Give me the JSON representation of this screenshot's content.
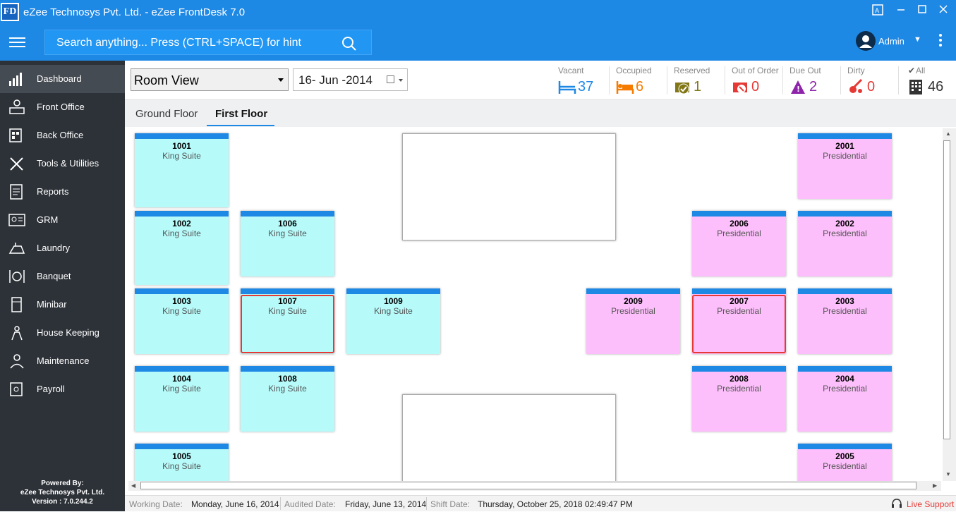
{
  "window": {
    "title": "eZee Technosys Pvt. Ltd. - eZee FrontDesk 7.0",
    "logo": "FD"
  },
  "header": {
    "search_placeholder": "Search anything... Press (CTRL+SPACE) for hint",
    "user": "Admin"
  },
  "sidebar": {
    "items": [
      {
        "label": "Dashboard",
        "icon": "dashboard-icon"
      },
      {
        "label": "Front Office",
        "icon": "front-office-icon"
      },
      {
        "label": "Back Office",
        "icon": "back-office-icon"
      },
      {
        "label": "Tools & Utilities",
        "icon": "tools-icon"
      },
      {
        "label": "Reports",
        "icon": "reports-icon"
      },
      {
        "label": "GRM",
        "icon": "grm-icon"
      },
      {
        "label": "Laundry",
        "icon": "laundry-icon"
      },
      {
        "label": "Banquet",
        "icon": "banquet-icon"
      },
      {
        "label": "Minibar",
        "icon": "minibar-icon"
      },
      {
        "label": "House Keeping",
        "icon": "housekeeping-icon"
      },
      {
        "label": "Maintenance",
        "icon": "maintenance-icon"
      },
      {
        "label": "Payroll",
        "icon": "payroll-icon"
      }
    ],
    "powered_by": "Powered By:",
    "company": "eZee Technosys Pvt. Ltd.",
    "version": "Version : 7.0.244.2"
  },
  "toolbar": {
    "view": "Room View",
    "date": "16- Jun -2014",
    "stats": {
      "vacant": {
        "label": "Vacant",
        "value": "37",
        "color": "#1e88e5"
      },
      "occupied": {
        "label": "Occupied",
        "value": "6",
        "color": "#f57c00"
      },
      "reserved": {
        "label": "Reserved",
        "value": "1",
        "color": "#827717"
      },
      "out_of_order": {
        "label": "Out of Order",
        "value": "0",
        "color": "#e53935"
      },
      "due_out": {
        "label": "Due Out",
        "value": "2",
        "color": "#8e24aa"
      },
      "dirty": {
        "label": "Dirty",
        "value": "0",
        "color": "#e53935"
      },
      "all": {
        "label": "All",
        "value": "46",
        "color": "#333333"
      }
    }
  },
  "tabs": [
    "Ground Floor",
    "First Floor"
  ],
  "rooms": {
    "r1001": {
      "number": "1001",
      "type": "King Suite"
    },
    "r1002": {
      "number": "1002",
      "type": "King Suite"
    },
    "r1003": {
      "number": "1003",
      "type": "King Suite"
    },
    "r1004": {
      "number": "1004",
      "type": "King Suite"
    },
    "r1005": {
      "number": "1005",
      "type": "King Suite"
    },
    "r1006": {
      "number": "1006",
      "type": "King Suite"
    },
    "r1007": {
      "number": "1007",
      "type": "King Suite"
    },
    "r1008": {
      "number": "1008",
      "type": "King Suite"
    },
    "r1009": {
      "number": "1009",
      "type": "King Suite"
    },
    "r2001": {
      "number": "2001",
      "type": "Presidential"
    },
    "r2002": {
      "number": "2002",
      "type": "Presidential"
    },
    "r2003": {
      "number": "2003",
      "type": "Presidential"
    },
    "r2004": {
      "number": "2004",
      "type": "Presidential"
    },
    "r2005": {
      "number": "2005",
      "type": "Presidential"
    },
    "r2006": {
      "number": "2006",
      "type": "Presidential"
    },
    "r2007": {
      "number": "2007",
      "type": "Presidential"
    },
    "r2008": {
      "number": "2008",
      "type": "Presidential"
    },
    "r2009": {
      "number": "2009",
      "type": "Presidential"
    }
  },
  "status": {
    "working_date_label": "Working Date:",
    "working_date": "Monday, June 16, 2014",
    "audited_date_label": "Audited Date:",
    "audited_date": "Friday, June 13, 2014",
    "shift_date_label": "Shift Date:",
    "shift_date": "Thursday, October 25, 2018 02:49:47 PM",
    "live_support": "Live Support"
  }
}
